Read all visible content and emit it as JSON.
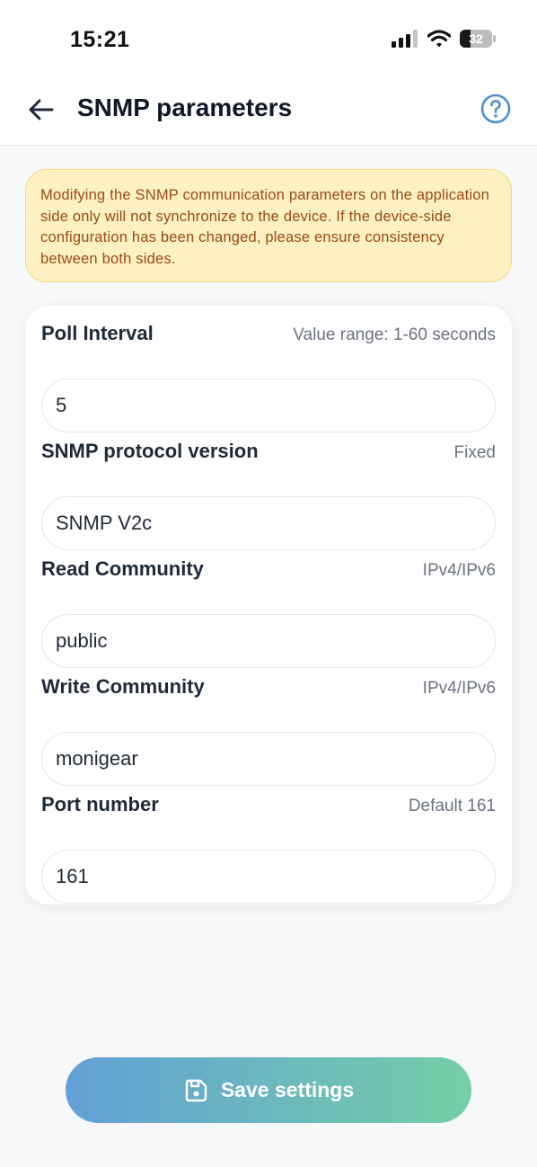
{
  "status_bar": {
    "time": "15:21",
    "battery": "32"
  },
  "header": {
    "title": "SNMP parameters"
  },
  "notice": {
    "text": "Modifying the SNMP communication parameters on the application side only will not synchronize to the device. If the device-side configuration has been changed, please ensure consistency between both sides."
  },
  "fields": [
    {
      "label": "Poll Interval",
      "hint": "Value range: 1-60 seconds",
      "value": "5"
    },
    {
      "label": "SNMP protocol version",
      "hint": "Fixed",
      "value": "SNMP V2c"
    },
    {
      "label": "Read Community",
      "hint": "IPv4/IPv6",
      "value": "public"
    },
    {
      "label": "Write Community",
      "hint": "IPv4/IPv6",
      "value": "monigear"
    },
    {
      "label": "Port number",
      "hint": "Default 161",
      "value": "161"
    }
  ],
  "save_button": {
    "label": "Save settings"
  },
  "colors": {
    "accent": "#5b9bd5",
    "gradient_end": "#6ecda2",
    "notice_bg": "#fdf1c4",
    "notice_text": "#9a4a12"
  },
  "icons": [
    "cellular-signal-icon",
    "wifi-icon",
    "battery-icon",
    "back-arrow-icon",
    "help-icon",
    "save-icon"
  ]
}
